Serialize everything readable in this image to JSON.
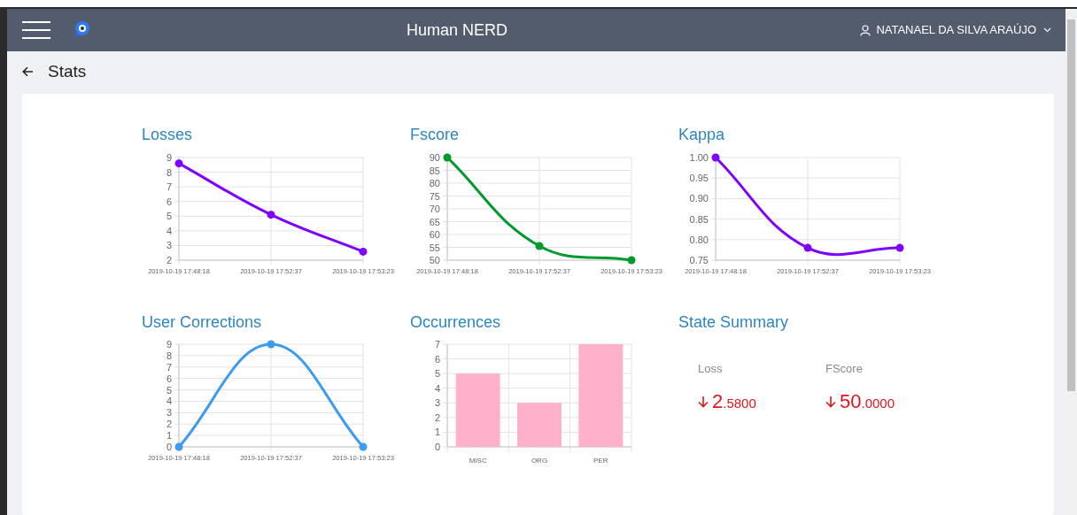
{
  "navbar": {
    "title": "Human NERD",
    "user": "NATANAEL DA SILVA ARAÚJO"
  },
  "page": {
    "title": "Stats"
  },
  "panels": [
    {
      "kind": "chart",
      "title": "Losses",
      "chart_data": {
        "type": "line",
        "categories": [
          "2019-10-19 17:48:18",
          "2019-10-19 17:52:37",
          "2019-10-19 17:53:23"
        ],
        "grid": true,
        "series": [
          {
            "color": "#7f00ff",
            "marker": true,
            "values": [
              8.6,
              5.1,
              2.58
            ]
          }
        ],
        "ylim": [
          2,
          9
        ],
        "yticks": [
          2,
          3,
          4,
          5,
          6,
          7,
          8,
          9
        ]
      }
    },
    {
      "kind": "chart",
      "title": "Fscore",
      "chart_data": {
        "type": "line",
        "categories": [
          "2019-10-19 17:48:18",
          "2019-10-19 17:52:37",
          "2019-10-19 17:53:23"
        ],
        "grid": true,
        "series": [
          {
            "color": "#00992e",
            "marker": true,
            "values": [
              90,
              55.5,
              50
            ]
          }
        ],
        "ylim": [
          50,
          90
        ],
        "yticks": [
          50,
          55,
          60,
          65,
          70,
          75,
          80,
          85,
          90
        ]
      }
    },
    {
      "kind": "chart",
      "title": "Kappa",
      "chart_data": {
        "type": "line",
        "categories": [
          "2019-10-19 17:48:18",
          "2019-10-19 17:52:37",
          "2019-10-19 17:53:23"
        ],
        "grid": true,
        "series": [
          {
            "color": "#7f00ff",
            "marker": true,
            "values": [
              1.0,
              0.78,
              0.78
            ]
          }
        ],
        "ylim": [
          0.75,
          1.0
        ],
        "yticks": [
          {
            "value": 0.75,
            "label": "0.75"
          },
          {
            "value": 0.8,
            "label": "0.80"
          },
          {
            "value": 0.85,
            "label": "0.85"
          },
          {
            "value": 0.9,
            "label": "0.90"
          },
          {
            "value": 0.95,
            "label": "0.95"
          },
          {
            "value": 1.0,
            "label": "1.00"
          }
        ]
      }
    },
    {
      "kind": "chart",
      "title": "User Corrections",
      "chart_data": {
        "type": "line",
        "categories": [
          "2019-10-19 17:48:18",
          "2019-10-19 17:52:37",
          "2019-10-19 17:53:23"
        ],
        "grid": true,
        "series": [
          {
            "color": "#3d9bf0",
            "marker": true,
            "values": [
              0,
              9,
              0
            ]
          }
        ],
        "ylim": [
          0,
          9
        ],
        "yticks": [
          0,
          1,
          2,
          3,
          4,
          5,
          6,
          7,
          8,
          9
        ]
      }
    },
    {
      "kind": "chart",
      "title": "Occurrences",
      "chart_data": {
        "type": "bar",
        "categories": [
          "MISC",
          "ORG",
          "PER"
        ],
        "grid": true,
        "series": [
          {
            "color": "#ffb0cb",
            "values": [
              5,
              3,
              7
            ]
          }
        ],
        "ylim": [
          0,
          7
        ],
        "yticks": [
          0,
          1,
          2,
          3,
          4,
          5,
          6,
          7
        ]
      }
    },
    {
      "kind": "summary",
      "title": "State Summary",
      "items": [
        {
          "label": "Loss",
          "whole": "2",
          "fraction": ".5800",
          "falling": true
        },
        {
          "label": "FScore",
          "whole": "50",
          "fraction": ".0000",
          "falling": true
        }
      ]
    }
  ]
}
